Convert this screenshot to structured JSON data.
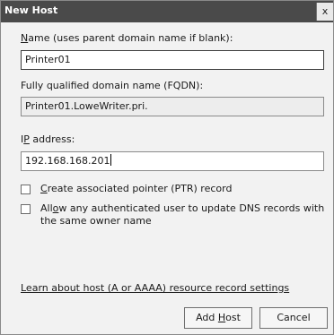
{
  "window": {
    "title": "New Host",
    "close_symbol": "x"
  },
  "name": {
    "label": "Name (uses parent domain name if blank):",
    "value": "Printer01"
  },
  "fqdn": {
    "label": "Fully qualified domain name (FQDN):",
    "value": "Printer01.LoweWriter.pri."
  },
  "ip": {
    "label": "IP address:",
    "value": "192.168.168.201"
  },
  "options": {
    "create_ptr_label": "Create associated pointer (PTR) record",
    "create_ptr_checked": false,
    "allow_update_label": "Allow any authenticated user to update DNS records with the same owner name",
    "allow_update_checked": false
  },
  "learn_link": "Learn about host (A or AAAA) resource record settings",
  "buttons": {
    "add_host": "Add Host",
    "cancel": "Cancel"
  }
}
